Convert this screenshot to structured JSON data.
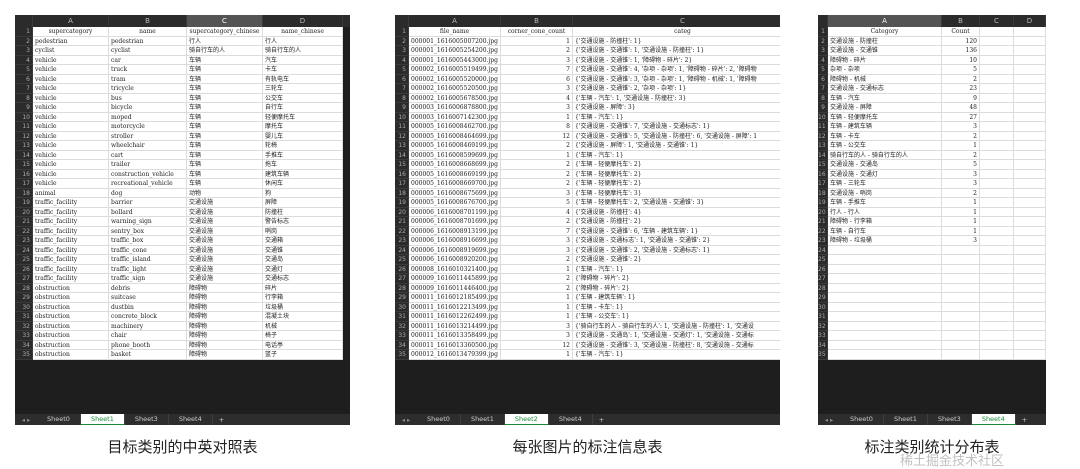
{
  "panels": [
    {
      "id": "p1",
      "columns": [
        "A",
        "B",
        "C",
        "D"
      ],
      "selected_column": "C",
      "widths": {
        "rn": 18,
        "cols": [
          76,
          78,
          76,
          80
        ]
      },
      "header": [
        "supercategory",
        "name",
        "supercategory_chinese",
        "name_chinese"
      ],
      "rows": [
        [
          "pedestrian",
          "pedestrian",
          "行人",
          "行人"
        ],
        [
          "cyclist",
          "cyclist",
          "骑自行车的人",
          "骑自行车的人"
        ],
        [
          "vehicle",
          "car",
          "车辆",
          "汽车"
        ],
        [
          "vehicle",
          "truck",
          "车辆",
          "卡车"
        ],
        [
          "vehicle",
          "tram",
          "车辆",
          "有轨电车"
        ],
        [
          "vehicle",
          "tricycle",
          "车辆",
          "三轮车"
        ],
        [
          "vehicle",
          "bus",
          "车辆",
          "公交车"
        ],
        [
          "vehicle",
          "bicycle",
          "车辆",
          "自行车"
        ],
        [
          "vehicle",
          "moped",
          "车辆",
          "轻便摩托车"
        ],
        [
          "vehicle",
          "motorcycle",
          "车辆",
          "摩托车"
        ],
        [
          "vehicle",
          "stroller",
          "车辆",
          "婴儿车"
        ],
        [
          "vehicle",
          "wheelchair",
          "车辆",
          "轮椅"
        ],
        [
          "vehicle",
          "cart",
          "车辆",
          "手推车"
        ],
        [
          "vehicle",
          "trailer",
          "车辆",
          "拖车"
        ],
        [
          "vehicle",
          "construction_vehicle",
          "车辆",
          "建筑车辆"
        ],
        [
          "vehicle",
          "recreational_vehicle",
          "车辆",
          "休闲车"
        ],
        [
          "animal",
          "dog",
          "动物",
          "狗"
        ],
        [
          "traffic_facility",
          "barrier",
          "交通设施",
          "屏障"
        ],
        [
          "traffic_facility",
          "bollard",
          "交通设施",
          "防撞柱"
        ],
        [
          "traffic_facility",
          "warning_sign",
          "交通设施",
          "警告标志"
        ],
        [
          "traffic_facility",
          "sentry_box",
          "交通设施",
          "哨岗"
        ],
        [
          "traffic_facility",
          "traffic_box",
          "交通设施",
          "交通箱"
        ],
        [
          "traffic_facility",
          "traffic_cone",
          "交通设施",
          "交通锥"
        ],
        [
          "traffic_facility",
          "traffic_island",
          "交通设施",
          "交通岛"
        ],
        [
          "traffic_facility",
          "traffic_light",
          "交通设施",
          "交通灯"
        ],
        [
          "traffic_facility",
          "traffic_sign",
          "交通设施",
          "交通标志"
        ],
        [
          "obstruction",
          "debris",
          "障碍物",
          "碎片"
        ],
        [
          "obstruction",
          "suitcase",
          "障碍物",
          "行李箱"
        ],
        [
          "obstruction",
          "dustbin",
          "障碍物",
          "垃圾桶"
        ],
        [
          "obstruction",
          "concrete_block",
          "障碍物",
          "混凝土块"
        ],
        [
          "obstruction",
          "machinery",
          "障碍物",
          "机械"
        ],
        [
          "obstruction",
          "chair",
          "障碍物",
          "椅子"
        ],
        [
          "obstruction",
          "phone_booth",
          "障碍物",
          "电话亭"
        ],
        [
          "obstruction",
          "basket",
          "障碍物",
          "篮子"
        ]
      ],
      "tabs": [
        "Sheet0",
        "Sheet1",
        "Sheet3",
        "Sheet4"
      ],
      "active_tab": "Sheet1"
    },
    {
      "id": "p2",
      "columns": [
        "A",
        "B",
        "C"
      ],
      "selected_column": "",
      "widths": {
        "rn": 14,
        "cols": [
          92,
          72,
          220
        ]
      },
      "header": [
        "file_name",
        "corner_cone_count",
        "categ"
      ],
      "rows": [
        [
          "000001_1616005007200.jpg",
          "1",
          "{'交通设施 - 防撞柱': 1}"
        ],
        [
          "000001_1616005254200.jpg",
          "2",
          "{'交通设施 - 交通锥': 1, '交通设施 - 防撞柱': 1}"
        ],
        [
          "000001_1616005443000.jpg",
          "3",
          "{'交通设施 - 交通锥': 1, '障碍物 - 碎片': 2}"
        ],
        [
          "000002_1616005519499.jpg",
          "7",
          "{'交通设施 - 交通锥': 4, '杂项 - 杂项': 1, '障碍物 - 碎片': 2, '障碍物"
        ],
        [
          "000002_1616005520000.jpg",
          "6",
          "{'交通设施 - 交通锥': 3, '杂项 - 杂项': 1, '障碍物 - 机械': 1, '障碍物"
        ],
        [
          "000002_1616005520500.jpg",
          "3",
          "{'交通设施 - 交通锥': 2, '杂项 - 杂项': 1}"
        ],
        [
          "000002_1616005678500.jpg",
          "4",
          "{'车辆 - 汽车': 1, '交通设施 - 防撞柱': 3}"
        ],
        [
          "000003_1616006878800.jpg",
          "3",
          "{'交通设施 - 屏障': 3}"
        ],
        [
          "000003_1616007142300.jpg",
          "1",
          "{'车辆 - 汽车': 1}"
        ],
        [
          "000005_1616008462700.jpg",
          "8",
          "{'交通设施 - 交通锥': 7, '交通设施 - 交通标志': 1}"
        ],
        [
          "000005_1616008464699.jpg",
          "12",
          "{'交通设施 - 交通锥': 5, '交通设施 - 防撞柱': 6, '交通设施 - 屏障': 1"
        ],
        [
          "000005_1616008469199.jpg",
          "2",
          "{'交通设施 - 屏障': 1, '交通设施 - 交通锥': 1}"
        ],
        [
          "000005_1616008599699.jpg",
          "1",
          "{'车辆 - 汽车': 1}"
        ],
        [
          "000005_1616008668699.jpg",
          "2",
          "{'车辆 - 轻便摩托车': 2}"
        ],
        [
          "000005_1616008669199.jpg",
          "2",
          "{'车辆 - 轻便摩托车': 2}"
        ],
        [
          "000005_1616008669700.jpg",
          "2",
          "{'车辆 - 轻便摩托车': 2}"
        ],
        [
          "000005_1616008675699.jpg",
          "3",
          "{'车辆 - 轻便摩托车': 3}"
        ],
        [
          "000005_1616008676700.jpg",
          "5",
          "{'车辆 - 轻便摩托车': 2, '交通设施 - 交通锥': 3}"
        ],
        [
          "000006_1616008701199.jpg",
          "4",
          "{'交通设施 - 防撞柱': 4}"
        ],
        [
          "000006_1616008701699.jpg",
          "2",
          "{'交通设施 - 防撞柱': 2}"
        ],
        [
          "000006_1616008913199.jpg",
          "7",
          "{'交通设施 - 交通锥': 6, '车辆 - 建筑车辆': 1}"
        ],
        [
          "000006_1616008916699.jpg",
          "3",
          "{'交通设施 - 交通标志': 1, '交通设施 - 交通锥': 2}"
        ],
        [
          "000006_1616008919699.jpg",
          "3",
          "{'交通设施 - 交通锥': 2, '交通设施 - 交通标志': 1}"
        ],
        [
          "000006_1616008920200.jpg",
          "2",
          "{'交通设施 - 交通锥': 2}"
        ],
        [
          "000008_1616010321400.jpg",
          "1",
          "{'车辆 - 汽车': 1}"
        ],
        [
          "000009_1616011445899.jpg",
          "2",
          "{'障碍物 - 碎片': 2}"
        ],
        [
          "000009_1616011446400.jpg",
          "2",
          "{'障碍物 - 碎片': 2}"
        ],
        [
          "000011_1616012185499.jpg",
          "1",
          "{'车辆 - 建筑车辆': 1}"
        ],
        [
          "000011_1616012213499.jpg",
          "1",
          "{'车辆 - 卡车': 1}"
        ],
        [
          "000011_1616012262499.jpg",
          "1",
          "{'车辆 - 公交车': 1}"
        ],
        [
          "000011_1616013214499.jpg",
          "3",
          "{'骑自行车的人 - 骑自行车的人': 1, '交通设施 - 防撞柱': 1, '交通设"
        ],
        [
          "000011_1616013358499.jpg",
          "3",
          "{'交通设施 - 交通岛': 1, '交通设施 - 交通灯': 1, '交通设施 - 交通标"
        ],
        [
          "000011_1616013360500.jpg",
          "12",
          "{'交通设施 - 交通锥': 3, '交通设施 - 防撞柱': 8, '交通设施 - 交通标"
        ],
        [
          "000012_1616013479399.jpg",
          "1",
          "{'车辆 - 汽车': 1}"
        ]
      ],
      "tabs": [
        "Sheet0",
        "Sheet1",
        "Sheet2",
        "Sheet4"
      ],
      "active_tab": "Sheet2"
    },
    {
      "id": "p3",
      "columns": [
        "A",
        "B",
        "C",
        "D"
      ],
      "selected_column": "A",
      "widths": {
        "rn": 10,
        "cols": [
          114,
          38,
          34,
          32
        ]
      },
      "header": [
        "Category",
        "Count",
        "",
        ""
      ],
      "rows": [
        [
          "交通设施 - 防撞柱",
          "120",
          "",
          ""
        ],
        [
          "交通设施 - 交通锥",
          "136",
          "",
          ""
        ],
        [
          "障碍物 - 碎片",
          "10",
          "",
          ""
        ],
        [
          "杂项 - 杂项",
          "5",
          "",
          ""
        ],
        [
          "障碍物 - 机械",
          "2",
          "",
          ""
        ],
        [
          "交通设施 - 交通标志",
          "23",
          "",
          ""
        ],
        [
          "车辆 - 汽车",
          "9",
          "",
          ""
        ],
        [
          "交通设施 - 屏障",
          "48",
          "",
          ""
        ],
        [
          "车辆 - 轻便摩托车",
          "27",
          "",
          ""
        ],
        [
          "车辆 - 建筑车辆",
          "3",
          "",
          ""
        ],
        [
          "车辆 - 卡车",
          "2",
          "",
          ""
        ],
        [
          "车辆 - 公交车",
          "1",
          "",
          ""
        ],
        [
          "骑自行车的人 - 骑自行车的人",
          "2",
          "",
          ""
        ],
        [
          "交通设施 - 交通岛",
          "5",
          "",
          ""
        ],
        [
          "交通设施 - 交通灯",
          "3",
          "",
          ""
        ],
        [
          "车辆 - 三轮车",
          "3",
          "",
          ""
        ],
        [
          "交通设施 - 哨岗",
          "2",
          "",
          ""
        ],
        [
          "车辆 - 手推车",
          "1",
          "",
          ""
        ],
        [
          "行人 - 行人",
          "1",
          "",
          ""
        ],
        [
          "障碍物 - 行李箱",
          "1",
          "",
          ""
        ],
        [
          "车辆 - 自行车",
          "1",
          "",
          ""
        ],
        [
          "障碍物 - 垃圾桶",
          "3",
          "",
          ""
        ],
        [
          "",
          "",
          "",
          ""
        ],
        [
          "",
          "",
          "",
          ""
        ],
        [
          "",
          "",
          "",
          ""
        ],
        [
          "",
          "",
          "",
          ""
        ],
        [
          "",
          "",
          "",
          ""
        ],
        [
          "",
          "",
          "",
          ""
        ],
        [
          "",
          "",
          "",
          ""
        ],
        [
          "",
          "",
          "",
          ""
        ],
        [
          "",
          "",
          "",
          ""
        ],
        [
          "",
          "",
          "",
          ""
        ],
        [
          "",
          "",
          "",
          ""
        ],
        [
          "",
          "",
          "",
          ""
        ]
      ],
      "tabs": [
        "Sheet0",
        "Sheet1",
        "Sheet3",
        "Sheet4"
      ],
      "active_tab": "Sheet4"
    }
  ],
  "captions": [
    "目标类别的中英对照表",
    "每张图片的标注信息表",
    "标注类别统计分布表"
  ],
  "watermark": "稀土掘金技术社区"
}
